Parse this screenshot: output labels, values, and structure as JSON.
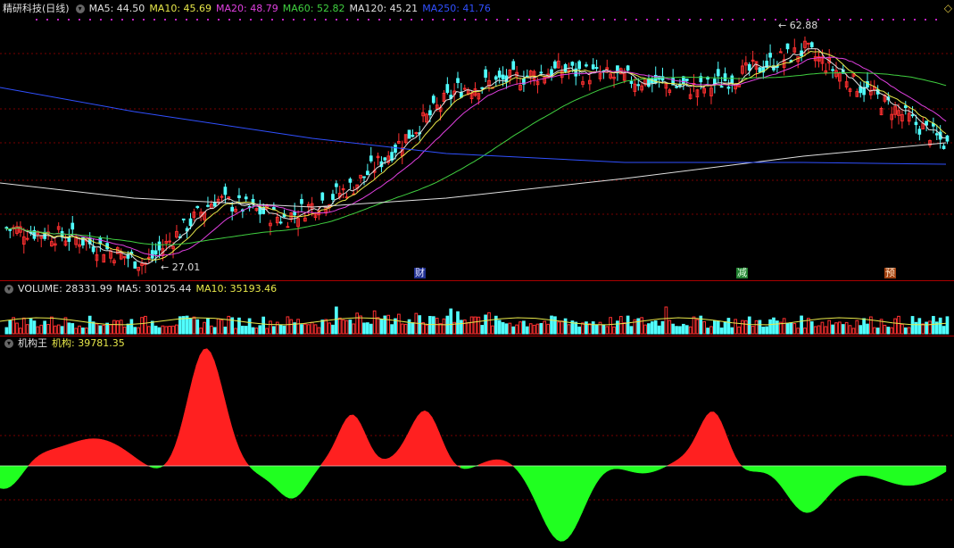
{
  "header": {
    "stock_name": "精研科技(日线)",
    "ma": [
      {
        "label": "MA5: 44.50",
        "color": "#e0e0e0"
      },
      {
        "label": "MA10: 45.69",
        "color": "#e8e84a"
      },
      {
        "label": "MA20: 48.79",
        "color": "#e040e0"
      },
      {
        "label": "MA60: 52.82",
        "color": "#40d040"
      },
      {
        "label": "MA120: 45.21",
        "color": "#e0e0e0"
      },
      {
        "label": "MA250: 41.76",
        "color": "#3050ff"
      }
    ]
  },
  "price_labels": {
    "high": "62.88",
    "low": "27.01"
  },
  "events": [
    {
      "label": "财",
      "bg": "#203090",
      "fg": "#e0e0ff"
    },
    {
      "label": "减",
      "bg": "#208030",
      "fg": "#e0ffe0"
    },
    {
      "label": "预",
      "bg": "#a04010",
      "fg": "#ffe0c0"
    }
  ],
  "volume_header": {
    "title": "VOLUME: 28331.99",
    "ma5": "MA5: 30125.44",
    "ma10": "MA10: 35193.46"
  },
  "indicator_header": {
    "title": "机构王",
    "value": "机构: 39781.35"
  },
  "colors": {
    "up": "#ff3030",
    "down": "#50ffff",
    "ma5": "#e0e0e0",
    "ma10": "#e8e84a",
    "ma20": "#e040e0",
    "ma60": "#40d040",
    "ma120": "#e0e0e0",
    "ma250": "#3050ff",
    "pos": "#ff2020",
    "neg": "#20ff20"
  },
  "chart_data": [
    {
      "type": "candlestick",
      "title": "精研科技(日线)",
      "y_range": [
        26,
        66
      ],
      "high_label": 62.88,
      "low_label": 27.01,
      "key_closes": [
        {
          "x": 0,
          "v": 33.5
        },
        {
          "x": 20,
          "v": 32
        },
        {
          "x": 40,
          "v": 28
        },
        {
          "x": 60,
          "v": 38
        },
        {
          "x": 80,
          "v": 35
        },
        {
          "x": 100,
          "v": 40
        },
        {
          "x": 130,
          "v": 55
        },
        {
          "x": 160,
          "v": 58
        },
        {
          "x": 200,
          "v": 55
        },
        {
          "x": 230,
          "v": 61
        },
        {
          "x": 250,
          "v": 54
        },
        {
          "x": 272,
          "v": 46
        }
      ]
    },
    {
      "type": "bar",
      "title": "VOLUME",
      "value": 28331.99,
      "ma5": 30125.44,
      "ma10": 35193.46
    },
    {
      "type": "area",
      "title": "机构王",
      "value": 39781.35
    }
  ]
}
